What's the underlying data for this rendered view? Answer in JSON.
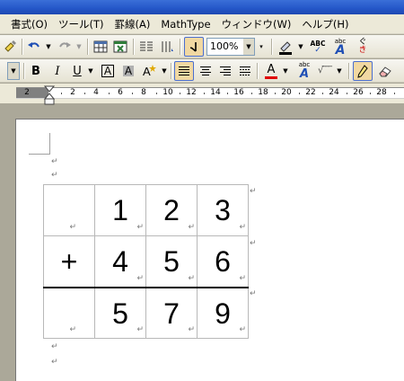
{
  "menu": {
    "items": [
      "書式(O)",
      "ツール(T)",
      "罫線(A)",
      "MathType",
      "ウィンドウ(W)",
      "ヘルプ(H)"
    ]
  },
  "toolbar_standard": {
    "zoom_value": "100%",
    "spell_label": "ABC",
    "kana_label": "abc"
  },
  "toolbar_format": {
    "bold": "B",
    "italic": "I",
    "underline": "U",
    "char_border": "A",
    "char_shading": "A",
    "font_color": "A",
    "phonetic": "abc",
    "phonetic_sub": "A",
    "sqrt": "√ ̅ ̅ ̅",
    "font_color_hex": "#e00000"
  },
  "ruler": {
    "labels": [
      "2",
      "2",
      "4",
      "6",
      "8",
      "10",
      "12",
      "14",
      "16",
      "18",
      "20",
      "22",
      "24",
      "26",
      "28"
    ]
  },
  "document": {
    "para_mark": "↵",
    "table": [
      [
        "",
        "1",
        "2",
        "3"
      ],
      [
        "+",
        "4",
        "5",
        "6"
      ],
      [
        "",
        "5",
        "7",
        "9"
      ]
    ]
  }
}
